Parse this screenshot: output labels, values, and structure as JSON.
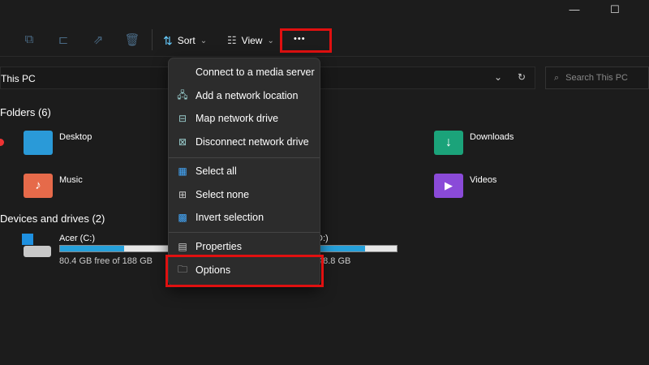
{
  "window": {
    "minimize": "—",
    "maximize": "☐",
    "close": "✕"
  },
  "toolbar": {
    "sort_label": "Sort",
    "view_label": "View",
    "more_label": "•••",
    "chevron": "⌄"
  },
  "address": {
    "path": "This PC",
    "search_placeholder": "Search This PC"
  },
  "sections": {
    "folders": "Folders (6)",
    "devices": "Devices and drives (2)"
  },
  "folders": [
    {
      "name": "Desktop",
      "color": "#2a9ad8"
    },
    {
      "name": "Downloads",
      "color": "#1ba37a"
    },
    {
      "name": "Music",
      "color": "#e66a4a"
    },
    {
      "name": "Videos",
      "color": "#8a4ad8"
    }
  ],
  "drives": [
    {
      "name": "Acer (C:)",
      "free_text": "80.4 GB free of 188 GB",
      "used_percent": 57
    },
    {
      "name": "D:)",
      "free_text": "48.8 GB",
      "used_percent": 64
    }
  ],
  "menu": {
    "items": [
      {
        "label": "Connect to a media server",
        "icon": "none"
      },
      {
        "label": "Add a network location",
        "icon": "network-location"
      },
      {
        "label": "Map network drive",
        "icon": "map-drive"
      },
      {
        "label": "Disconnect network drive",
        "icon": "disconnect-drive"
      },
      {
        "label": "Select all",
        "icon": "select-all"
      },
      {
        "label": "Select none",
        "icon": "select-none"
      },
      {
        "label": "Invert selection",
        "icon": "invert-selection"
      },
      {
        "label": "Properties",
        "icon": "properties"
      },
      {
        "label": "Options",
        "icon": "options"
      }
    ]
  },
  "colors": {
    "highlight": "#e01010",
    "accent": "#26a0da"
  }
}
